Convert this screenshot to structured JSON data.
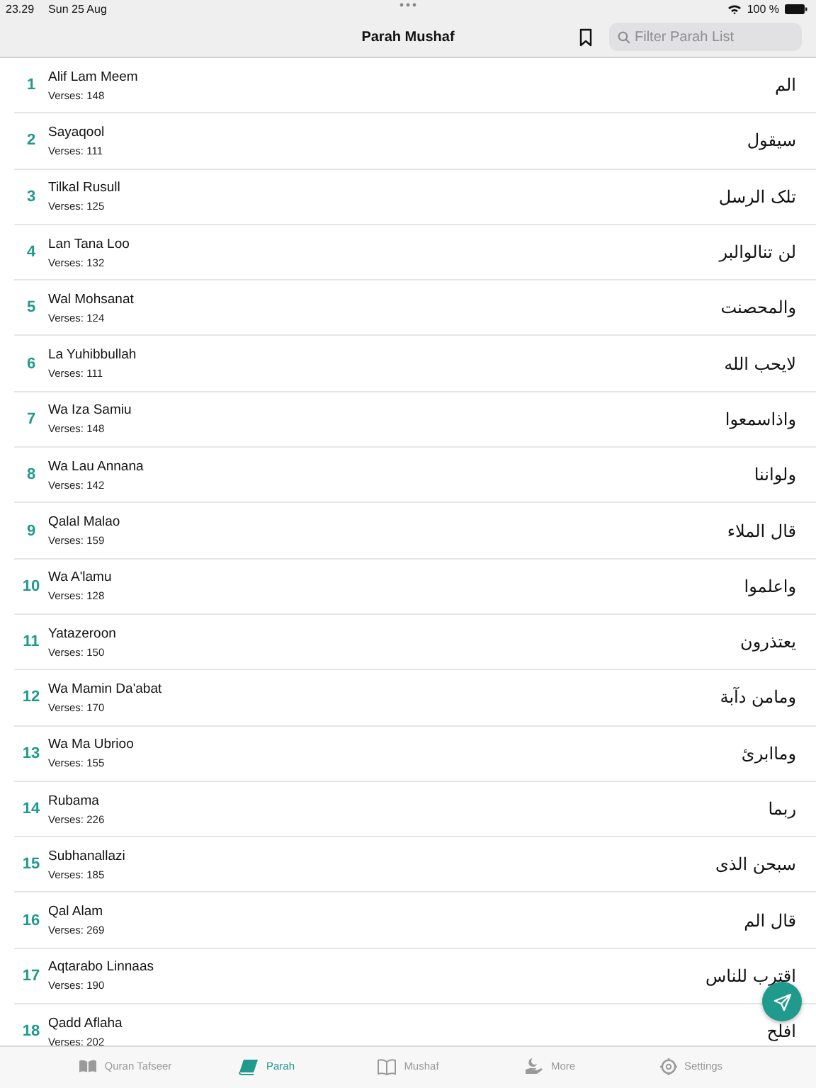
{
  "status_bar": {
    "time": "23.29",
    "date": "Sun 25 Aug",
    "battery": "100 %"
  },
  "nav_bar": {
    "title": "Parah Mushaf",
    "search": {
      "placeholder": "Filter Parah List"
    }
  },
  "parahs": [
    {
      "number": "1",
      "name": "Alif Lam Meem",
      "verses": "Verses: 148",
      "arabic": "الم"
    },
    {
      "number": "2",
      "name": "Sayaqool",
      "verses": "Verses: 111",
      "arabic": "سيقول"
    },
    {
      "number": "3",
      "name": "Tilkal Rusull",
      "verses": "Verses: 125",
      "arabic": "تلک الرسل"
    },
    {
      "number": "4",
      "name": "Lan Tana Loo",
      "verses": "Verses: 132",
      "arabic": "لن تنالوالبر"
    },
    {
      "number": "5",
      "name": "Wal Mohsanat",
      "verses": "Verses: 124",
      "arabic": "والمحصنت"
    },
    {
      "number": "6",
      "name": "La Yuhibbullah",
      "verses": "Verses: 111",
      "arabic": "لايحب الله"
    },
    {
      "number": "7",
      "name": "Wa Iza Samiu",
      "verses": "Verses: 148",
      "arabic": "واذاسمعوا"
    },
    {
      "number": "8",
      "name": "Wa Lau Annana",
      "verses": "Verses: 142",
      "arabic": "ولواننا"
    },
    {
      "number": "9",
      "name": "Qalal Malao",
      "verses": "Verses: 159",
      "arabic": "قال الملاء"
    },
    {
      "number": "10",
      "name": "Wa A'lamu",
      "verses": "Verses: 128",
      "arabic": "واعلموا"
    },
    {
      "number": "11",
      "name": "Yatazeroon",
      "verses": "Verses: 150",
      "arabic": "يعتذرون"
    },
    {
      "number": "12",
      "name": "Wa Mamin Da'abat",
      "verses": "Verses: 170",
      "arabic": "ومامن دآبة"
    },
    {
      "number": "13",
      "name": "Wa Ma Ubrioo",
      "verses": "Verses: 155",
      "arabic": "وماابرئ"
    },
    {
      "number": "14",
      "name": "Rubama",
      "verses": "Verses: 226",
      "arabic": "ربما"
    },
    {
      "number": "15",
      "name": "Subhanallazi",
      "verses": "Verses: 185",
      "arabic": "سبحن الذى"
    },
    {
      "number": "16",
      "name": "Qal Alam",
      "verses": "Verses: 269",
      "arabic": "قال الم"
    },
    {
      "number": "17",
      "name": "Aqtarabo Linnaas",
      "verses": "Verses: 190",
      "arabic": "اقترب للناس"
    },
    {
      "number": "18",
      "name": "Qadd Aflaha",
      "verses": "Verses: 202",
      "arabic": "افلح"
    }
  ],
  "tab_bar": [
    {
      "label": "Quran Tafseer",
      "kind": "books",
      "selected": false
    },
    {
      "label": "Parah",
      "kind": "book",
      "selected": true
    },
    {
      "label": "Mushaf",
      "kind": "reader",
      "selected": false
    },
    {
      "label": "More",
      "kind": "more",
      "selected": false
    },
    {
      "label": "Settings",
      "kind": "settings",
      "selected": false
    }
  ]
}
